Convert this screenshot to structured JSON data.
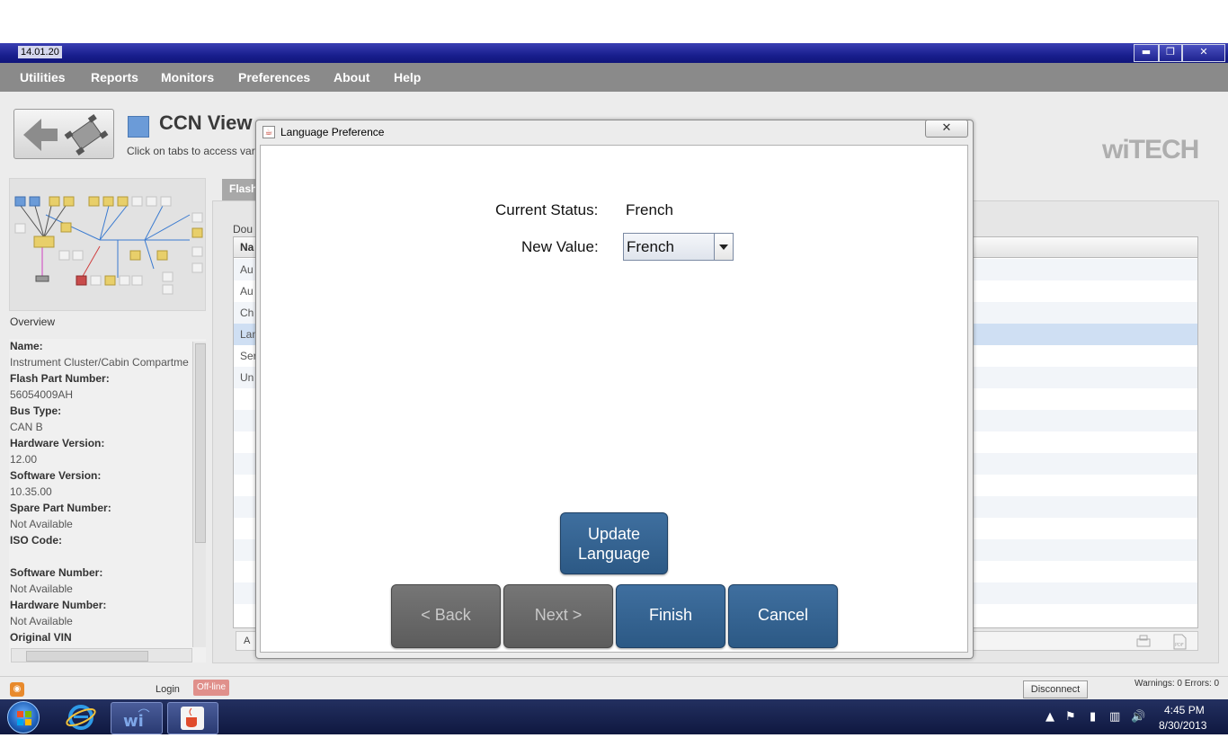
{
  "window": {
    "title": "14.01.20",
    "minimize": "▬",
    "restore": "❐",
    "close": "✕"
  },
  "menu": [
    "Utilities",
    "Reports",
    "Monitors",
    "Preferences",
    "About",
    "Help"
  ],
  "header": {
    "title": "CCN View",
    "hint": "Click on tabs to access var",
    "logo": "wiTECH"
  },
  "overview_label": "Overview",
  "info": [
    {
      "label": "Name:",
      "bold": true
    },
    {
      "label": "Instrument Cluster/Cabin Compartme",
      "bold": false
    },
    {
      "label": "Flash Part Number:",
      "bold": true
    },
    {
      "label": "56054009AH",
      "bold": false
    },
    {
      "label": "Bus Type:",
      "bold": true
    },
    {
      "label": "CAN B",
      "bold": false
    },
    {
      "label": "Hardware Version:",
      "bold": true
    },
    {
      "label": "12.00",
      "bold": false
    },
    {
      "label": "Software Version:",
      "bold": true
    },
    {
      "label": "10.35.00",
      "bold": false
    },
    {
      "label": "Spare Part Number:",
      "bold": true
    },
    {
      "label": "Not Available",
      "bold": false
    },
    {
      "label": "ISO Code:",
      "bold": true
    },
    {
      "label": "",
      "bold": false
    },
    {
      "label": "Software Number:",
      "bold": true
    },
    {
      "label": "Not Available",
      "bold": false
    },
    {
      "label": "Hardware Number:",
      "bold": true
    },
    {
      "label": "Not Available",
      "bold": false
    },
    {
      "label": "Original VIN",
      "bold": true
    }
  ],
  "tab": {
    "label": "Flash"
  },
  "table": {
    "hint": "Dou",
    "header": "Na",
    "rows": [
      "Au",
      "Au",
      "Ch",
      "Lan",
      "Ser",
      "Un"
    ],
    "footer": "A"
  },
  "dialog": {
    "title": "Language Preference",
    "close": "✕",
    "current_status_label": "Current Status:",
    "current_status_value": "French",
    "new_value_label": "New Value:",
    "new_value_selected": "French",
    "update_button": [
      "Update",
      "Language"
    ],
    "back_button": "< Back",
    "next_button": "Next >",
    "finish_button": "Finish",
    "cancel_button": "Cancel"
  },
  "status": {
    "login": "Login",
    "offline": "Off-line",
    "disconnect": "Disconnect",
    "warnings": "Warnings: 0 Errors: 0"
  },
  "taskbar": {
    "time": "4:45 PM",
    "date": "8/30/2013"
  }
}
